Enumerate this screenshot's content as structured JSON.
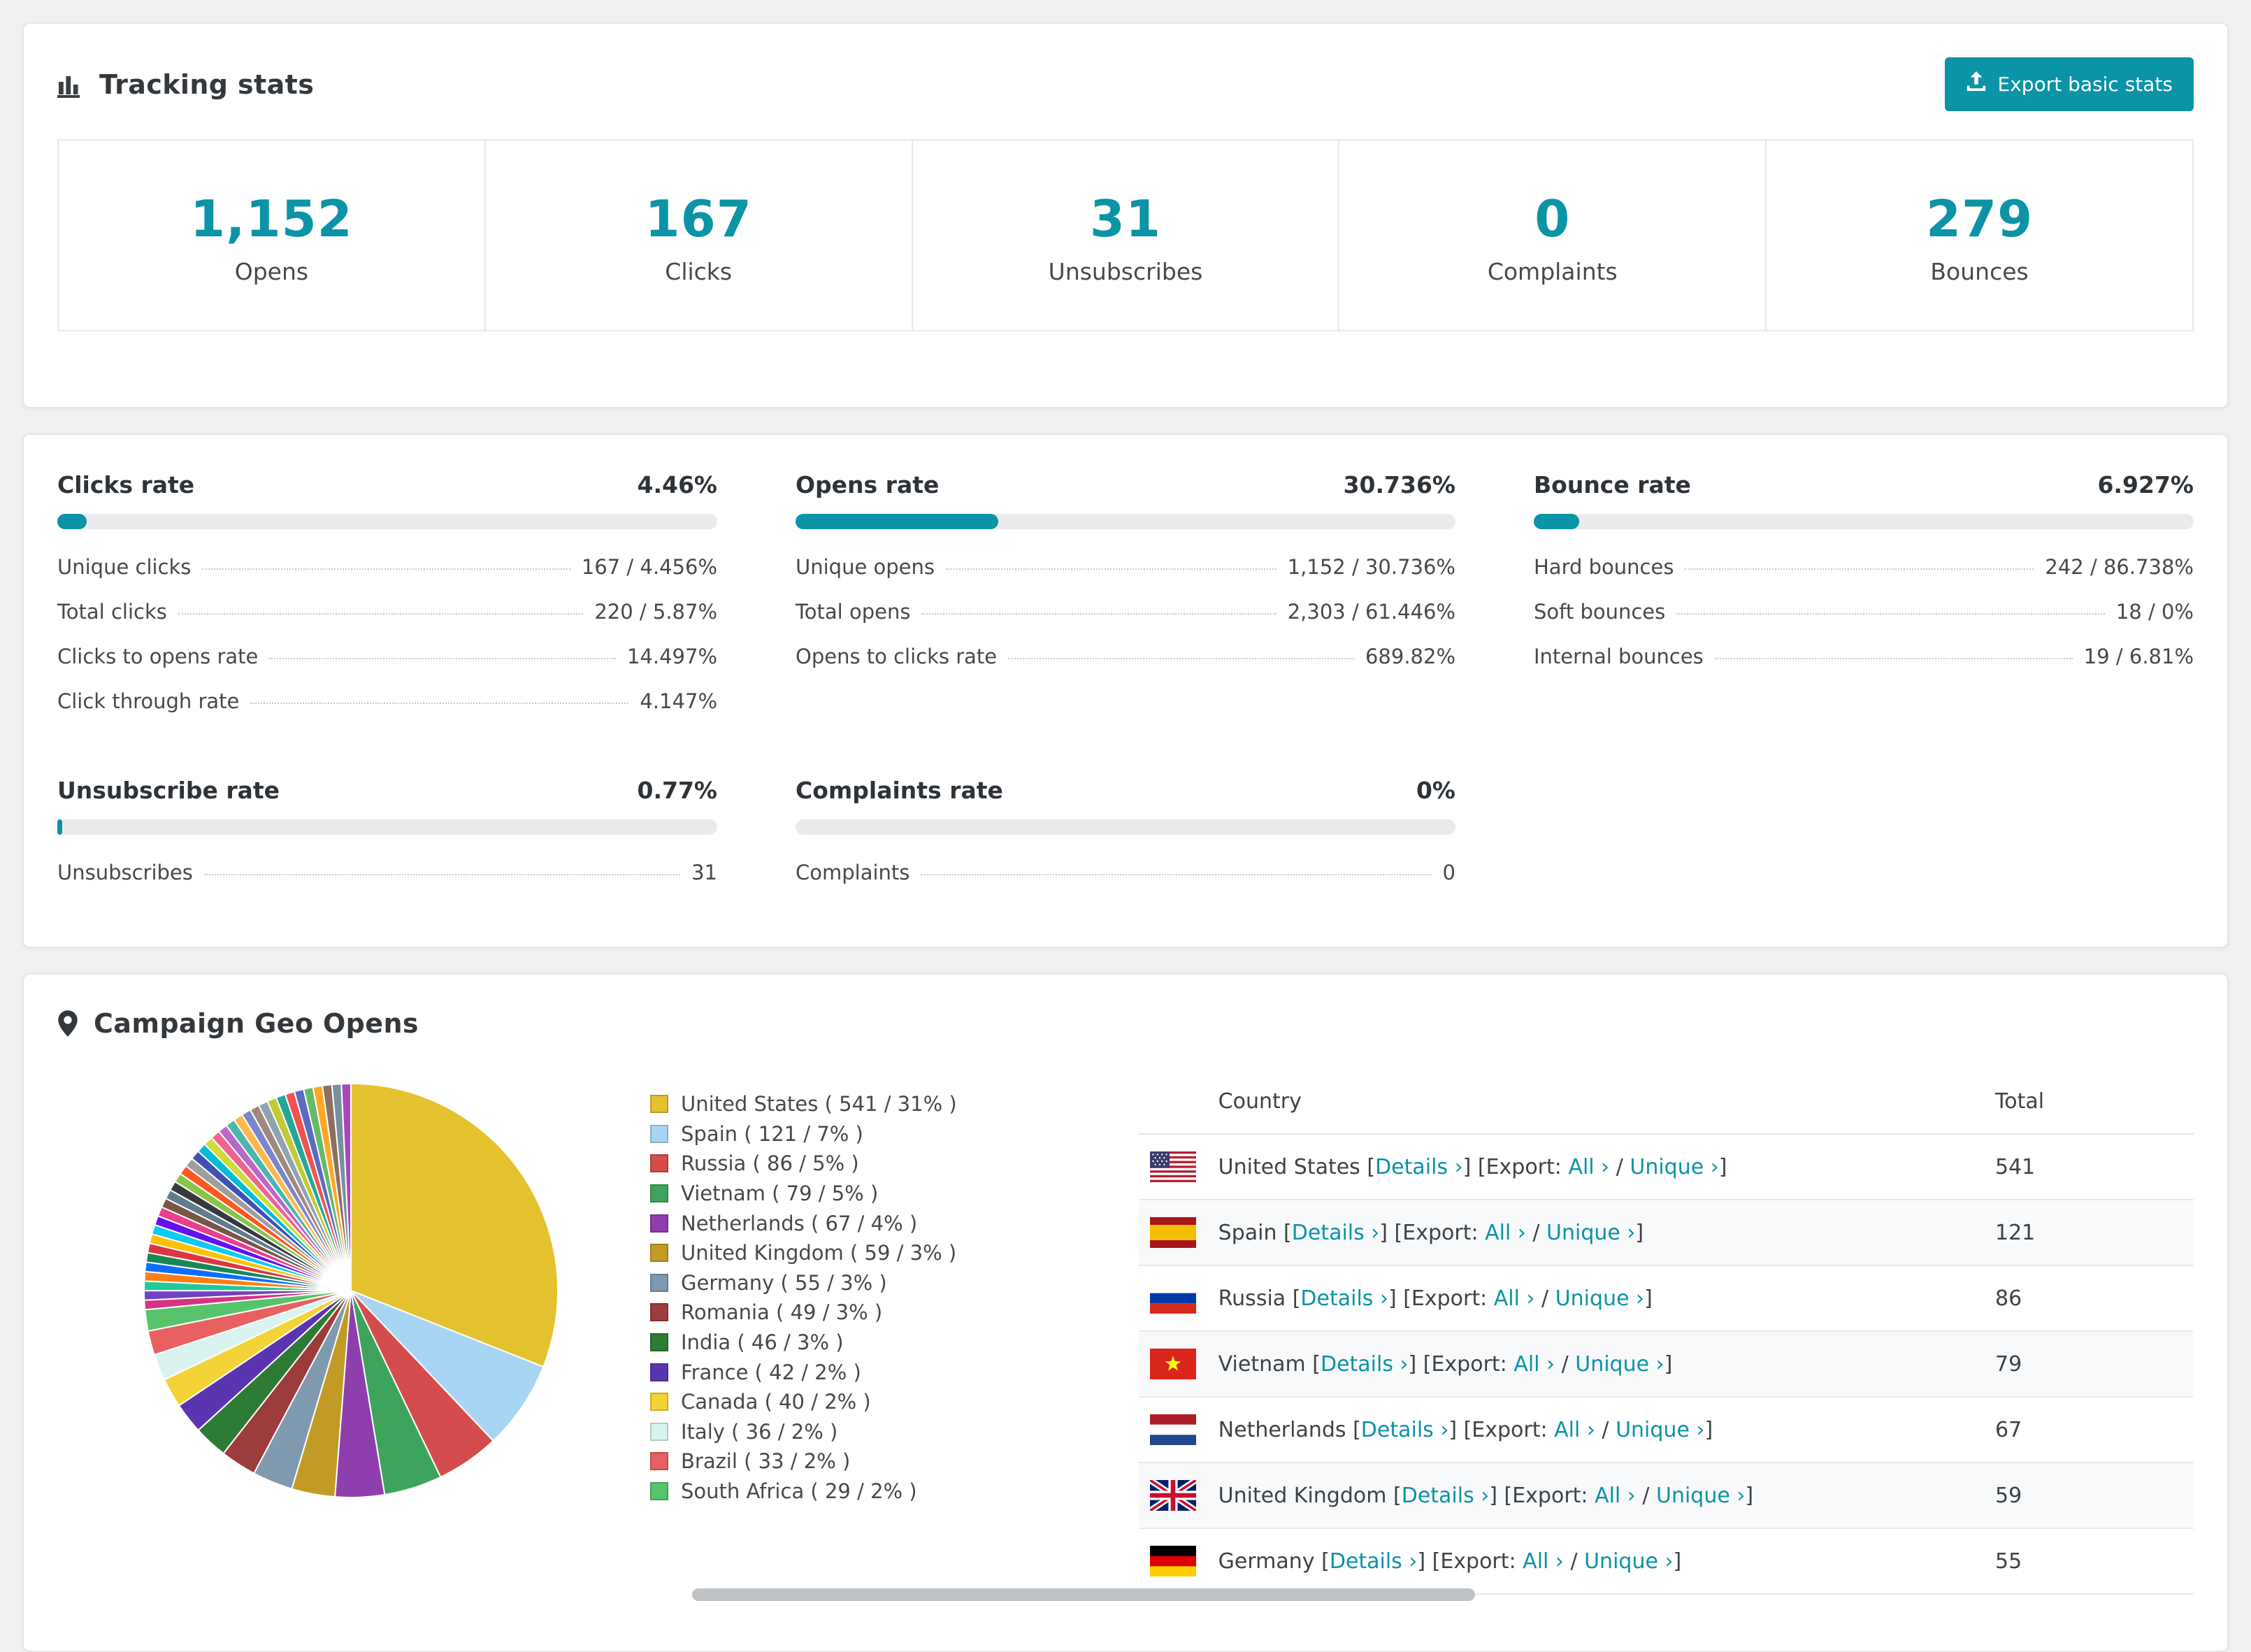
{
  "theme": {
    "accent": "#0b93a6",
    "page_bg": "#f0f1f2",
    "card_border": "#e4e6e8",
    "bar_track": "#e9ebed",
    "scrollbar": "#bec2c5"
  },
  "tracking": {
    "title": "Tracking stats",
    "export_button": "Export basic stats",
    "stats": [
      {
        "value": "1,152",
        "label": "Opens"
      },
      {
        "value": "167",
        "label": "Clicks"
      },
      {
        "value": "31",
        "label": "Unsubscribes"
      },
      {
        "value": "0",
        "label": "Complaints"
      },
      {
        "value": "279",
        "label": "Bounces"
      }
    ]
  },
  "rates": {
    "sections": [
      {
        "id": "clicks-rate",
        "title": "Clicks rate",
        "value": "4.46%",
        "bar_pct": 4.46,
        "rows": [
          {
            "label": "Unique clicks",
            "value": "167 / 4.456%"
          },
          {
            "label": "Total clicks",
            "value": "220 / 5.87%"
          },
          {
            "label": "Clicks to opens rate",
            "value": "14.497%"
          },
          {
            "label": "Click through rate",
            "value": "4.147%"
          }
        ]
      },
      {
        "id": "opens-rate",
        "title": "Opens rate",
        "value": "30.736%",
        "bar_pct": 30.736,
        "rows": [
          {
            "label": "Unique opens",
            "value": "1,152 / 30.736%"
          },
          {
            "label": "Total opens",
            "value": "2,303 / 61.446%"
          },
          {
            "label": "Opens to clicks rate",
            "value": "689.82%"
          }
        ]
      },
      {
        "id": "bounce-rate",
        "title": "Bounce rate",
        "value": "6.927%",
        "bar_pct": 6.927,
        "rows": [
          {
            "label": "Hard bounces",
            "value": "242 / 86.738%"
          },
          {
            "label": "Soft bounces",
            "value": "18 / 0%"
          },
          {
            "label": "Internal bounces",
            "value": "19 / 6.81%"
          }
        ]
      },
      {
        "id": "unsubscribe-rate",
        "title": "Unsubscribe rate",
        "value": "0.77%",
        "bar_pct": 0.77,
        "rows": [
          {
            "label": "Unsubscribes",
            "value": "31"
          }
        ]
      },
      {
        "id": "complaints-rate",
        "title": "Complaints rate",
        "value": "0%",
        "bar_pct": 0,
        "rows": [
          {
            "label": "Complaints",
            "value": "0"
          }
        ]
      }
    ]
  },
  "geo": {
    "title": "Campaign Geo Opens",
    "table": {
      "headers": {
        "country": "Country",
        "total": "Total"
      },
      "labels": {
        "details": "Details",
        "export": "Export:",
        "all": "All",
        "unique": "Unique",
        "arrow": "›",
        "bracket_open": " [",
        "bracket_close_open": "] [",
        "separator": " / ",
        "bracket_close": "]"
      },
      "rows": [
        {
          "flag": "us",
          "country": "United States",
          "total": "541"
        },
        {
          "flag": "es",
          "country": "Spain",
          "total": "121"
        },
        {
          "flag": "ru",
          "country": "Russia",
          "total": "86"
        },
        {
          "flag": "vn",
          "country": "Vietnam",
          "total": "79"
        },
        {
          "flag": "nl",
          "country": "Netherlands",
          "total": "67"
        },
        {
          "flag": "gb",
          "country": "United Kingdom",
          "total": "59"
        },
        {
          "flag": "de",
          "country": "Germany",
          "total": "55"
        }
      ]
    }
  },
  "chart_data": {
    "type": "pie",
    "title": "Campaign Geo Opens",
    "legend_position": "right",
    "slices": [
      {
        "name": "United States",
        "value": 541,
        "pct": 31,
        "color": "#e4c12e"
      },
      {
        "name": "Spain",
        "value": 121,
        "pct": 7,
        "color": "#a8d5f2"
      },
      {
        "name": "Russia",
        "value": 86,
        "pct": 5,
        "color": "#d44c4c"
      },
      {
        "name": "Vietnam",
        "value": 79,
        "pct": 5,
        "color": "#3ea45c"
      },
      {
        "name": "Netherlands",
        "value": 67,
        "pct": 4,
        "color": "#8e3fad"
      },
      {
        "name": "United Kingdom",
        "value": 59,
        "pct": 3,
        "color": "#c29b26"
      },
      {
        "name": "Germany",
        "value": 55,
        "pct": 3,
        "color": "#7f99ae"
      },
      {
        "name": "Romania",
        "value": 49,
        "pct": 3,
        "color": "#9c3c3c"
      },
      {
        "name": "India",
        "value": 46,
        "pct": 3,
        "color": "#2d7b35"
      },
      {
        "name": "France",
        "value": 42,
        "pct": 2,
        "color": "#5b35b1"
      },
      {
        "name": "Canada",
        "value": 40,
        "pct": 2,
        "color": "#f3d335"
      },
      {
        "name": "Italy",
        "value": 36,
        "pct": 2,
        "color": "#d9f4f0"
      },
      {
        "name": "Brazil",
        "value": 33,
        "pct": 2,
        "color": "#e96060"
      },
      {
        "name": "South Africa",
        "value": 29,
        "pct": 2,
        "color": "#57c36b"
      }
    ],
    "others": {
      "total": 462,
      "segments": 36,
      "colors": [
        "#d63384",
        "#6f42c1",
        "#20c997",
        "#fd7e14",
        "#0d6efd",
        "#198754",
        "#dc3545",
        "#ffc107",
        "#0dcaf0",
        "#6610f2",
        "#e83e8c",
        "#795548",
        "#607d8b",
        "#343a40",
        "#8bc34a",
        "#ff5722",
        "#9e9e9e",
        "#3f51b5",
        "#00bcd4",
        "#cddc39",
        "#f06292",
        "#ba68c8",
        "#4db6ac",
        "#ffb74d",
        "#7986cb",
        "#a1887f",
        "#90a4ae",
        "#c0ca33",
        "#26a69a",
        "#ef5350",
        "#5c6bc0",
        "#66bb6a",
        "#ffa726",
        "#8d6e63",
        "#78909c",
        "#ab47bc"
      ]
    }
  }
}
